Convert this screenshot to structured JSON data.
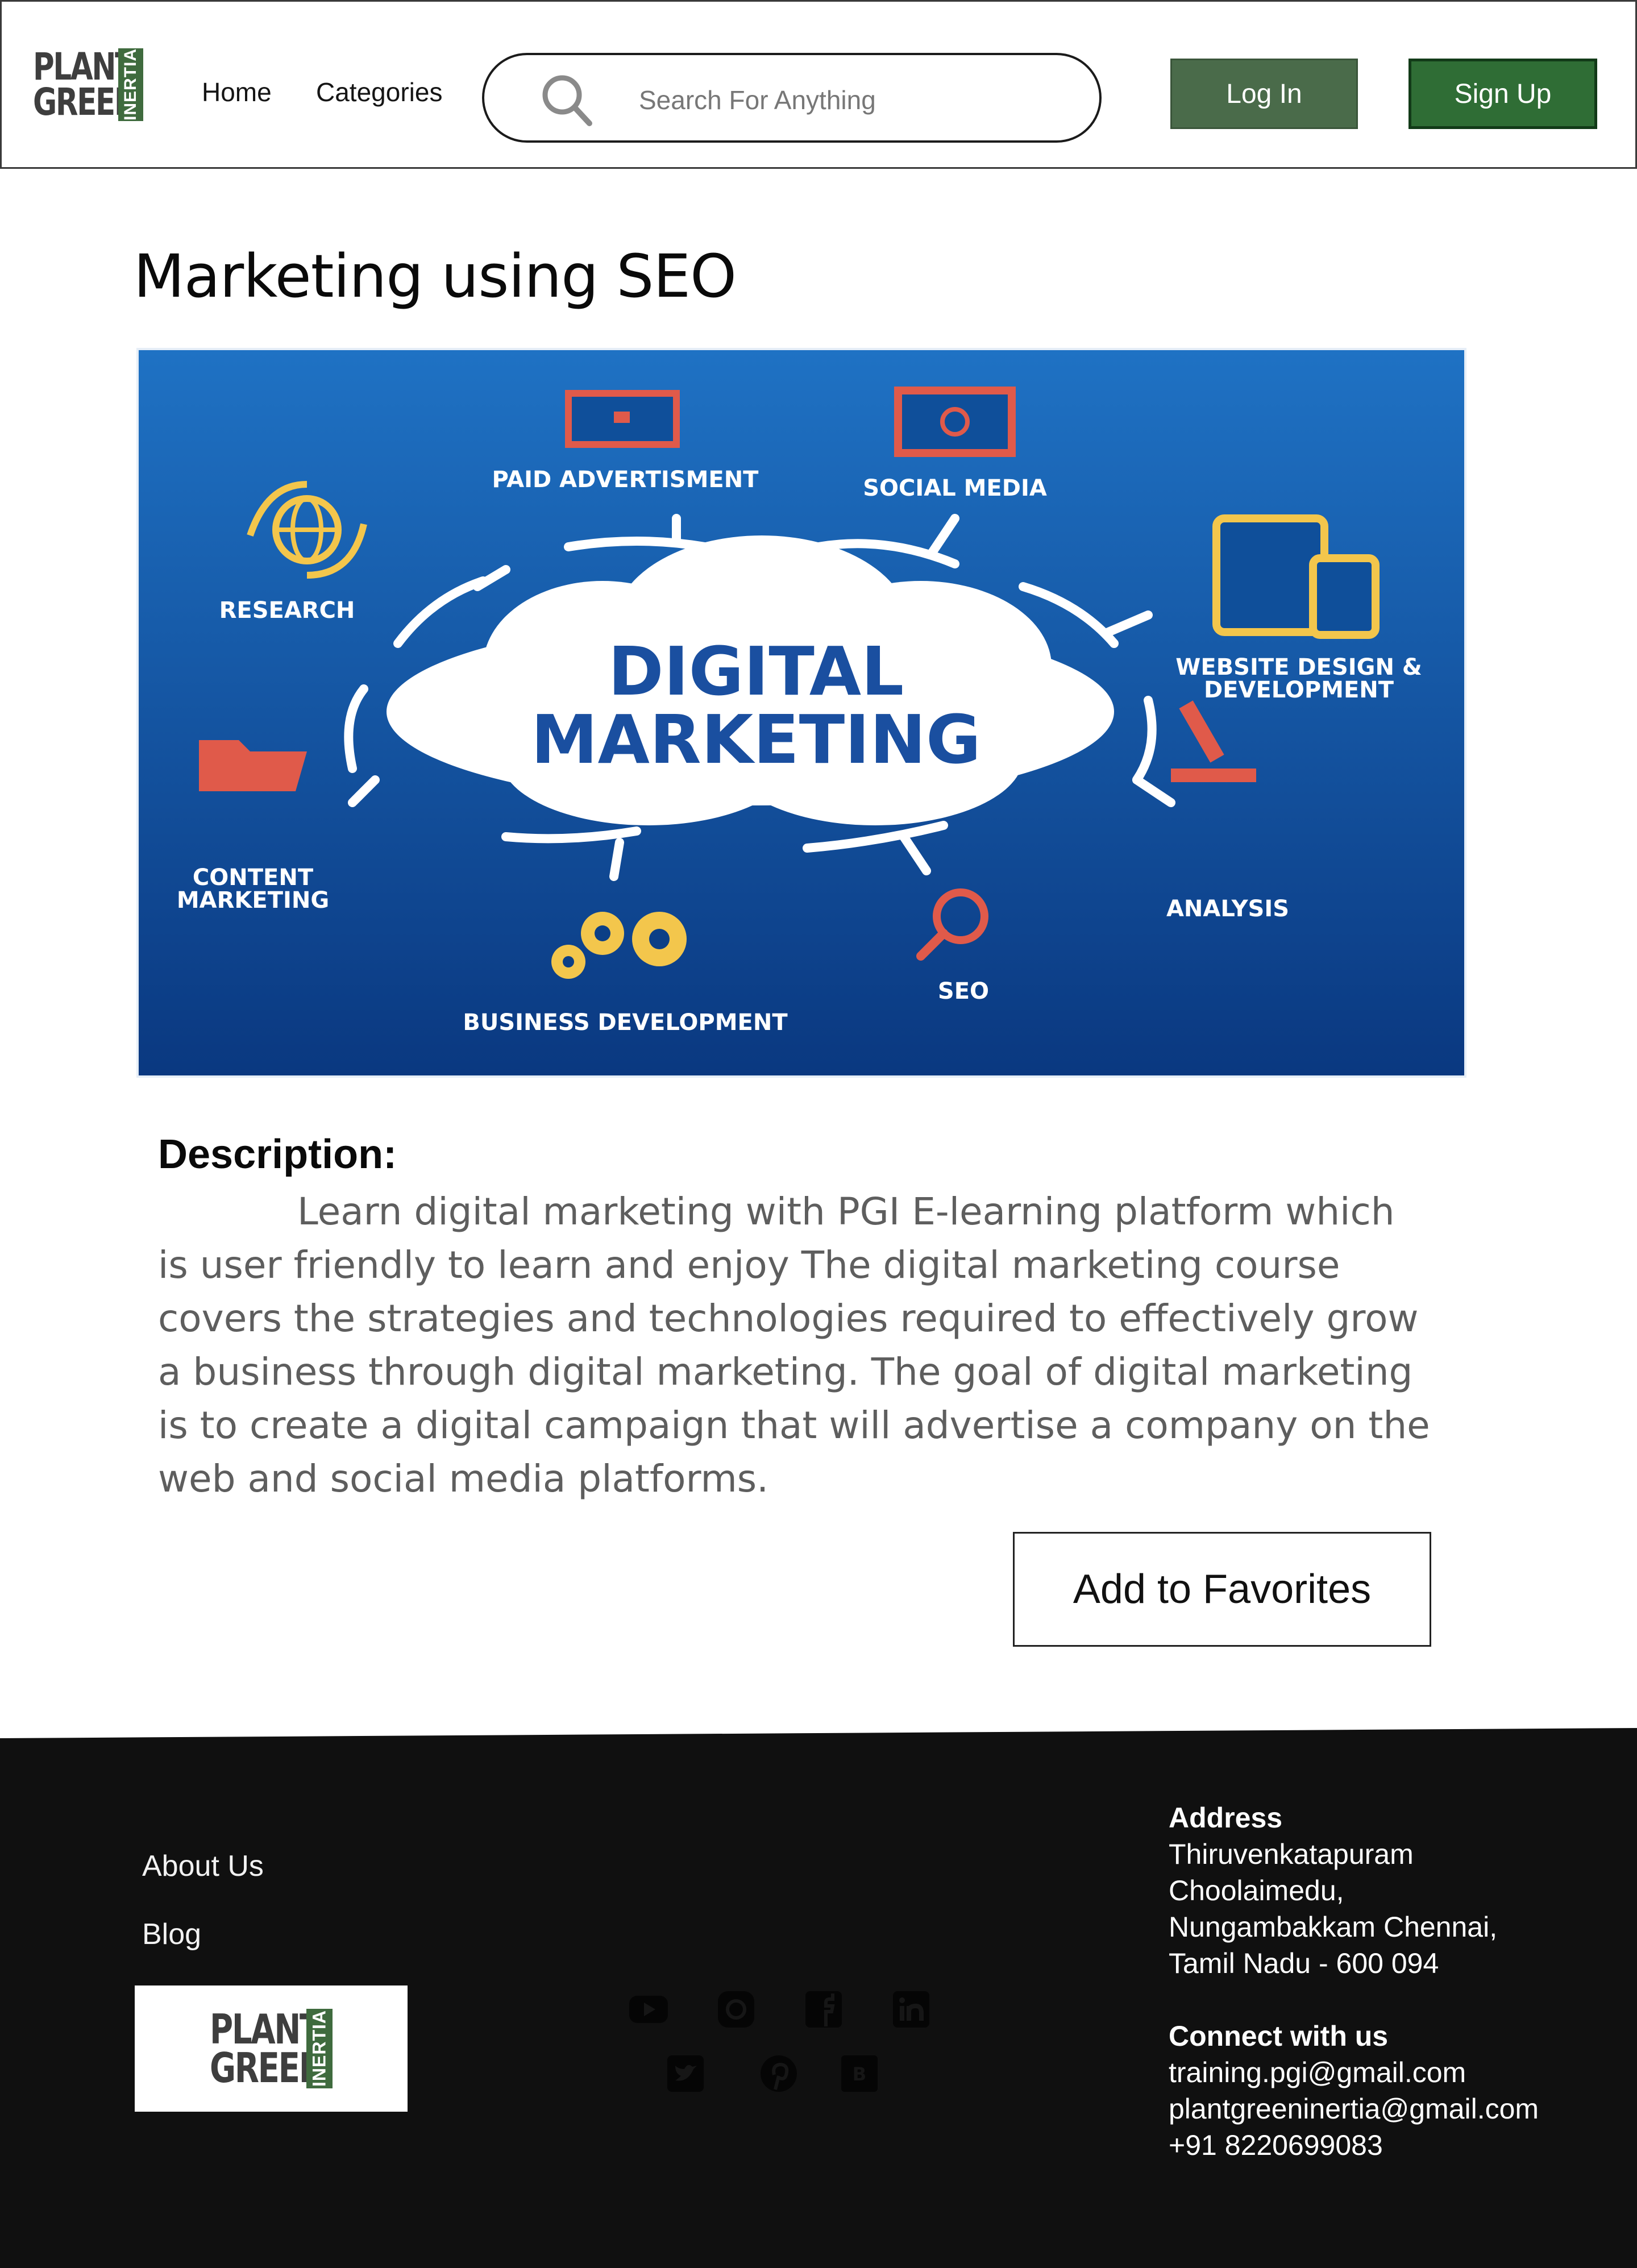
{
  "header": {
    "logo": {
      "line1": "PLANT",
      "line2": "GREEN",
      "tag": "INERTIA"
    },
    "nav": [
      {
        "label": "Home"
      },
      {
        "label": "Categories"
      }
    ],
    "search": {
      "placeholder": "Search For Anything",
      "icon": "search-icon"
    },
    "login_label": "Log In",
    "signup_label": "Sign Up",
    "colors": {
      "login_bg": "#4a6b4a",
      "signup_bg": "#2f6d35"
    }
  },
  "course": {
    "title": "Marketing using SEO",
    "image": {
      "center_line1": "DIGITAL",
      "center_line2": "MARKETING",
      "labels": {
        "paid": "PAID ADVERTISMENT",
        "social": "SOCIAL MEDIA",
        "research": "RESEARCH",
        "website1": "WEBSITE DESIGN &",
        "website2": "DEVELOPMENT",
        "content1": "CONTENT",
        "content2": "MARKETING",
        "analysis": "ANALYSIS",
        "seo": "SEO",
        "business": "BUSINESS DEVELOPMENT"
      },
      "colors": {
        "bg_top": "#1f6fc0",
        "bg_bottom": "#0b3c86",
        "accent_red": "#e05a4a",
        "accent_yellow": "#f3c64c",
        "text_blue": "#1a4fa0"
      }
    },
    "description_heading": "Description:",
    "description": "Learn digital marketing with PGI E-learning platform which is user friendly to learn and enjoy The digital marketing course covers the strategies and technologies required to effectively grow a business through digital marketing. The goal of digital marketing is to create a digital campaign that will advertise a company on the web and social media platforms.",
    "favorite_label": "Add to Favorites"
  },
  "footer": {
    "links": [
      {
        "label": "About  Us"
      },
      {
        "label": "Blog"
      }
    ],
    "logo": {
      "line1": "PLANT",
      "line2": "GREEN",
      "tag": "INERTIA"
    },
    "social_icons": [
      "youtube-icon",
      "instagram-icon",
      "facebook-icon",
      "linkedin-icon",
      "twitter-icon",
      "pinterest-icon",
      "behance-icon"
    ],
    "address_heading": "Address",
    "address_lines": [
      "Thiruvenkatapuram",
      "Choolaimedu,",
      "Nungambakkam Chennai,",
      "Tamil Nadu - 600 094"
    ],
    "connect_heading": "Connect with us",
    "contacts": [
      "training.pgi@gmail.com",
      "plantgreeninertia@gmail.com",
      "+91 8220699083"
    ]
  }
}
